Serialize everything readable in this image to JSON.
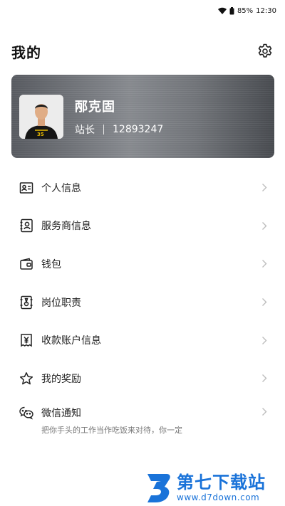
{
  "status_bar": {
    "battery": "85%",
    "time": "12:30"
  },
  "header": {
    "title": "我的"
  },
  "profile": {
    "name": "邴克固",
    "role": "站长",
    "id": "12893247"
  },
  "menu": [
    {
      "label": "个人信息",
      "icon": "id-card-icon"
    },
    {
      "label": "服务商信息",
      "icon": "provider-icon"
    },
    {
      "label": "钱包",
      "icon": "wallet-icon"
    },
    {
      "label": "岗位职责",
      "icon": "duty-icon"
    },
    {
      "label": "收款账户信息",
      "icon": "yen-receipt-icon"
    },
    {
      "label": "我的奖励",
      "icon": "star-icon"
    },
    {
      "label": "微信通知",
      "icon": "wechat-icon",
      "sub": "把你手头的工作当作吃饭来对待，你一定"
    }
  ],
  "watermark": {
    "text": "第七下载站",
    "url": "www.d7down.com"
  },
  "colors": {
    "card_dark": "#4a4d52",
    "card_light": "#8a8d92",
    "watermark_blue": "#1a73d9"
  }
}
